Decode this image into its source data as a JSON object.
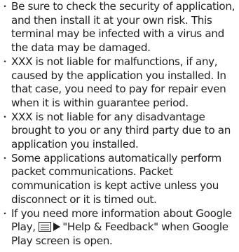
{
  "notes": {
    "bullet_char": "・",
    "items": [
      {
        "text": "Be sure to check the security of application, and then install it at your own risk. This terminal may be infected with a virus and the data may be damaged."
      },
      {
        "text": "XXX is not liable for malfunctions, if any, caused by the application you installed. In that case, you need to pay for repair even when it is within guarantee period."
      },
      {
        "text": "XXX is not liable for any disadvantage brought to you or any third party due to an application you installed."
      },
      {
        "text": "Some applications automatically perform packet communications. Packet communication is kept active unless you disconnect or it is timed out."
      },
      {
        "text_before_icons": "If you need more information about Google Play, ",
        "icons": [
          "menu-icon",
          "arrow-right-icon"
        ],
        "text_after_icons": "\"Help & Feedback\" when Google Play screen is open."
      }
    ]
  }
}
